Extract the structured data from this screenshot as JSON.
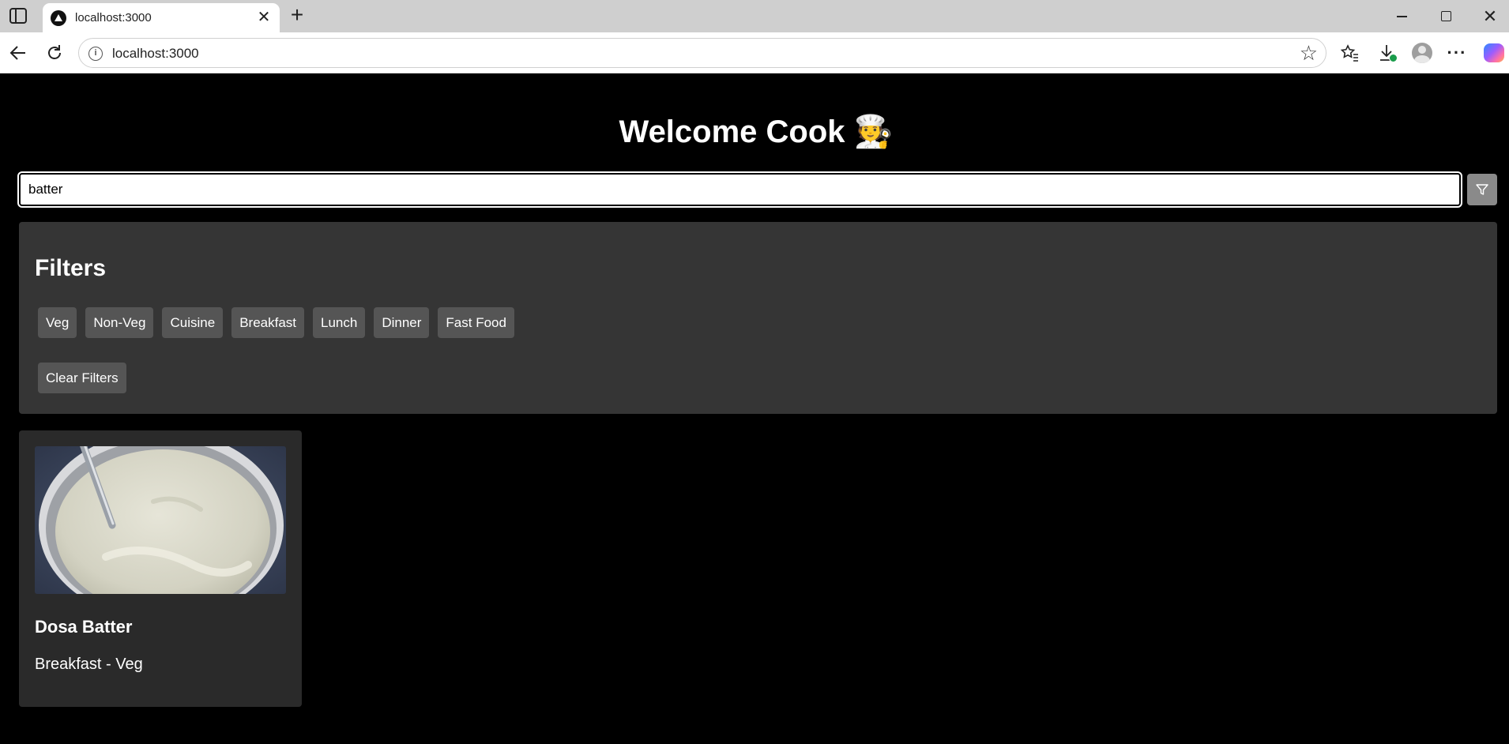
{
  "browser": {
    "tab_title": "localhost:3000",
    "tab_close": "✕",
    "new_tab": "+",
    "url": "localhost:3000",
    "window": {
      "minimize": "",
      "maximize": "",
      "close": "✕"
    }
  },
  "app": {
    "heading": "Welcome Cook 🧑‍🍳",
    "search": {
      "value": "batter",
      "placeholder": ""
    },
    "filters": {
      "title": "Filters",
      "chips": [
        "Veg",
        "Non-Veg",
        "Cuisine",
        "Breakfast",
        "Lunch",
        "Dinner",
        "Fast Food"
      ],
      "clear_label": "Clear Filters"
    },
    "results": [
      {
        "title": "Dosa Batter",
        "meta": "Breakfast - Veg"
      }
    ]
  },
  "colors": {
    "page_bg": "#000000",
    "panel_bg": "#353535",
    "chip_bg": "#555555",
    "card_bg": "#2a2a2a",
    "filter_button_bg": "#8a8a8a"
  },
  "icons": [
    "sidebar-toggle-icon",
    "favicon-icon",
    "back-arrow-icon",
    "reload-icon",
    "info-icon",
    "star-icon",
    "favorites-icon",
    "download-icon",
    "profile-icon",
    "more-icon",
    "copilot-icon",
    "filter-funnel-icon"
  ]
}
